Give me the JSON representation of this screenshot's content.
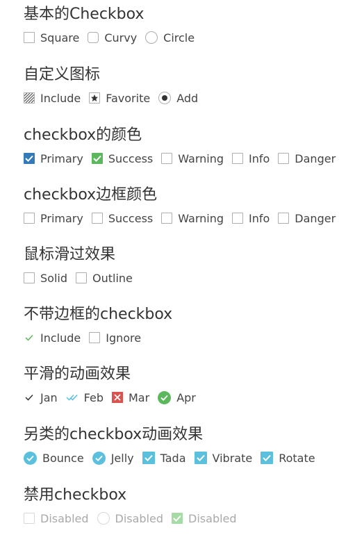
{
  "sections": {
    "basic": {
      "title": "基本的Checkbox",
      "items": [
        "Square",
        "Curvy",
        "Circle"
      ]
    },
    "custom_icons": {
      "title": "自定义图标",
      "items": [
        "Include",
        "Favorite",
        "Add"
      ]
    },
    "colors": {
      "title": "checkbox的颜色",
      "items": [
        "Primary",
        "Success",
        "Warning",
        "Info",
        "Danger"
      ]
    },
    "border_colors": {
      "title": "checkbox边框颜色",
      "items": [
        "Primary",
        "Success",
        "Warning",
        "Info",
        "Danger"
      ]
    },
    "hover": {
      "title": "鼠标滑过效果",
      "items": [
        "Solid",
        "Outline"
      ]
    },
    "borderless": {
      "title": "不带边框的checkbox",
      "items": [
        "Include",
        "Ignore"
      ]
    },
    "smooth": {
      "title": "平滑的动画效果",
      "items": [
        "Jan",
        "Feb",
        "Mar",
        "Apr"
      ]
    },
    "alt_animation": {
      "title": "另类的checkbox动画效果",
      "items": [
        "Bounce",
        "Jelly",
        "Tada",
        "Vibrate",
        "Rotate"
      ]
    },
    "disabled": {
      "title": "禁用checkbox",
      "items": [
        "Disabled",
        "Disabled",
        "Disabled"
      ]
    }
  },
  "colors": {
    "primary": "#337ab7",
    "success": "#5cb85c",
    "info": "#5bc0de",
    "danger": "#d9534f"
  }
}
